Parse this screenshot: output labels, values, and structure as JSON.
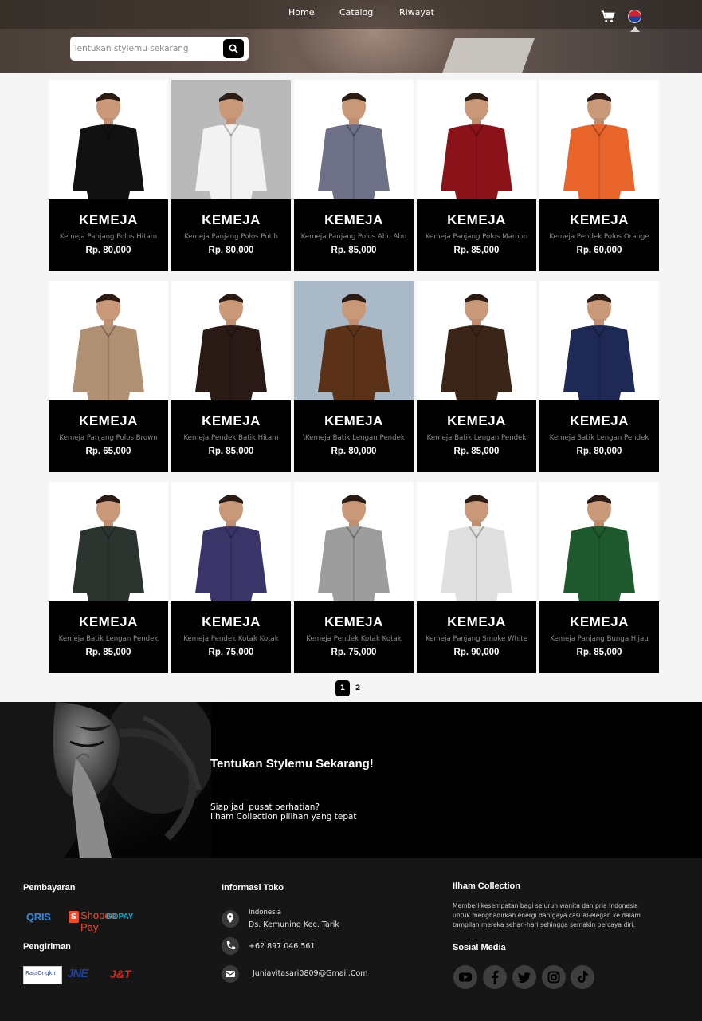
{
  "nav": {
    "links": [
      "Home",
      "Catalog",
      "Riwayat"
    ]
  },
  "search": {
    "placeholder": "Tentukan stylemu sekarang"
  },
  "products": [
    {
      "category": "KEMEJA",
      "name": "Kemeja Panjang Polos Hitam",
      "price": "Rp. 80,000",
      "shirt": "#111111",
      "bg": "#ffffff"
    },
    {
      "category": "KEMEJA",
      "name": "Kemeja Panjang Polos Putih",
      "price": "Rp. 80,000",
      "shirt": "#f2f2f2",
      "bg": "#b9b9b9"
    },
    {
      "category": "KEMEJA",
      "name": "Kemeja Panjang Polos Abu Abu",
      "price": "Rp. 85,000",
      "shirt": "#6d7086",
      "bg": "#ffffff"
    },
    {
      "category": "KEMEJA",
      "name": "Kemeja Panjang Polos Maroon",
      "price": "Rp. 85,000",
      "shirt": "#8a1218",
      "bg": "#ffffff"
    },
    {
      "category": "KEMEJA",
      "name": "Kemeja Pendek Polos Orange",
      "price": "Rp. 60,000",
      "shirt": "#e8642a",
      "bg": "#ffffff"
    },
    {
      "category": "KEMEJA",
      "name": "Kemeja Panjang Polos Brown",
      "price": "Rp. 65,000",
      "shirt": "#b09073",
      "bg": "#ffffff"
    },
    {
      "category": "KEMEJA",
      "name": "Kemeja Pendek Batik Hitam",
      "price": "Rp. 85,000",
      "shirt": "#2a1a16",
      "bg": "#ffffff"
    },
    {
      "category": "KEMEJA",
      "name": "\\Kemeja Batik Lengan Pendek",
      "price": "Rp. 80,000",
      "shirt": "#5b3218",
      "bg": "#a9b9c8"
    },
    {
      "category": "KEMEJA",
      "name": "Kemeja Batik Lengan Pendek",
      "price": "Rp. 85,000",
      "shirt": "#3b2418",
      "bg": "#ffffff"
    },
    {
      "category": "KEMEJA",
      "name": "Kemeja Batik Lengan Pendek",
      "price": "Rp. 80,000",
      "shirt": "#1e2a55",
      "bg": "#ffffff"
    },
    {
      "category": "KEMEJA",
      "name": "Kemeja Batik Lengan Pendek",
      "price": "Rp. 85,000",
      "shirt": "#2c3430",
      "bg": "#ffffff"
    },
    {
      "category": "KEMEJA",
      "name": "Kemeja Pendek Kotak Kotak",
      "price": "Rp. 75,000",
      "shirt": "#3a3568",
      "bg": "#ffffff"
    },
    {
      "category": "KEMEJA",
      "name": "Kemeja Pendek Kotak Kotak",
      "price": "Rp. 75,000",
      "shirt": "#9d9d9d",
      "bg": "#ffffff"
    },
    {
      "category": "KEMEJA",
      "name": "Kemeja Panjang Smoke White",
      "price": "Rp. 90,000",
      "shirt": "#e0e0e0",
      "bg": "#ffffff"
    },
    {
      "category": "KEMEJA",
      "name": "Kemeja Panjang Bunga Hijau",
      "price": "Rp. 85,000",
      "shirt": "#1f5a2e",
      "bg": "#ffffff"
    }
  ],
  "pagination": {
    "current": "1",
    "next": "2"
  },
  "promo": {
    "title": "Tentukan Stylemu Sekarang!",
    "line1": "Siap jadi pusat perhatian?",
    "line2": "Ilham Collection pilihan yang tepat"
  },
  "footer": {
    "payment_title": "Pembayaran",
    "payment": [
      "QRIS",
      "Shopee Pay",
      "GOPAY"
    ],
    "shipping_title": "Pengiriman",
    "shipping": [
      "RajaOngkir",
      "JNE",
      "J&T"
    ],
    "info_title": "Informasi Toko",
    "country": "Indonesia",
    "address": "Ds. Kemuning Kec. Tarik",
    "phone": "+62 897 046 561",
    "email": "Juniavitasari0809@Gmail.Com",
    "brand_title": "Ilham Collection",
    "about": "Memberi kesempatan bagi seluruh wanita dan pria Indonesia untuk menghadirkan energi dan gaya casual-elegan ke dalam tampilan mereka sehari-hari sehingga semakin percaya diri.",
    "social_title": "Sosial Media",
    "social": [
      "youtube-icon",
      "facebook-icon",
      "twitter-icon",
      "instagram-icon",
      "tiktok-icon"
    ]
  },
  "colors": {
    "accent": "#000000",
    "card_caption": "#000000",
    "footer_bg": "#161616"
  }
}
